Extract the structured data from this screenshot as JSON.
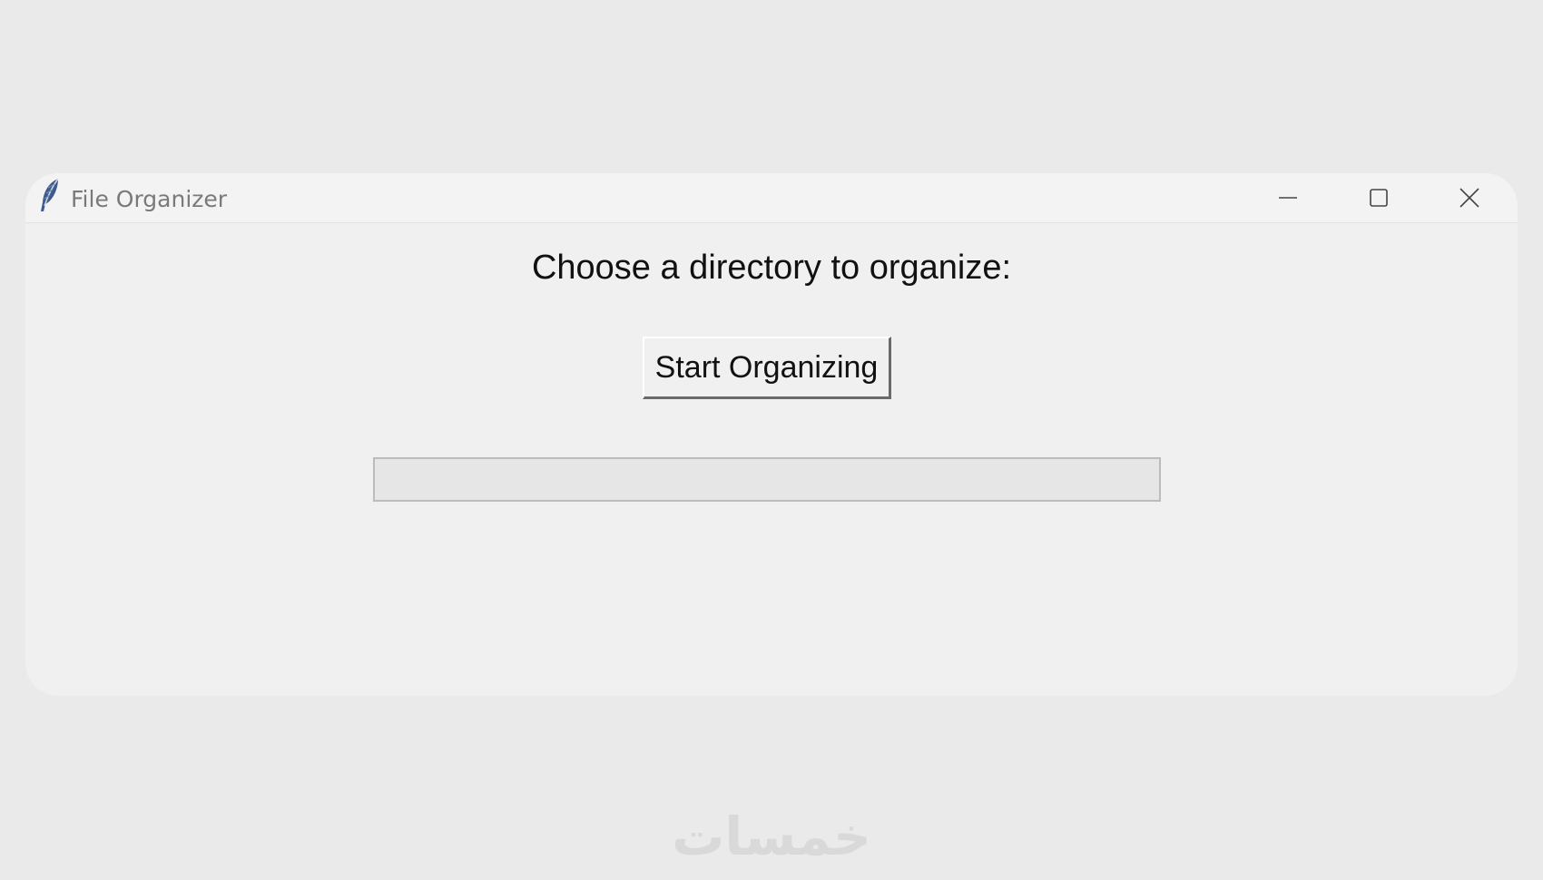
{
  "window": {
    "title": "File Organizer",
    "controls": {
      "minimize_icon": "minimize-icon",
      "maximize_icon": "maximize-icon",
      "close_icon": "close-icon"
    }
  },
  "main": {
    "heading": "Choose a directory to organize:",
    "start_button_label": "Start Organizing",
    "progress": 0
  },
  "watermark": {
    "text": "خمسات"
  },
  "colors": {
    "background": "#eaeaea",
    "window": "#f0f0f0",
    "progress_track": "#e6e6e6"
  }
}
